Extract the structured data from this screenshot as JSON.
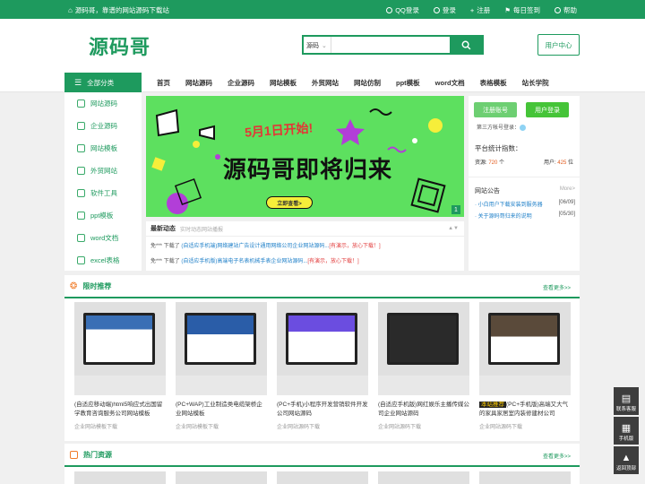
{
  "topbar": {
    "slogan": "源码哥，靠谱的网站源码下载站",
    "links": [
      "QQ登录",
      "登录",
      "注册",
      "每日签到",
      "帮助"
    ]
  },
  "header": {
    "logo": "源码哥",
    "search_type": "源码",
    "search_placeholder": "",
    "user_center": "用户中心"
  },
  "nav": {
    "all_label": "全部分类",
    "items": [
      "首页",
      "网站源码",
      "企业源码",
      "网站模板",
      "外贸网站",
      "网站仿制",
      "ppt模板",
      "word文档",
      "表格模板",
      "站长学院"
    ]
  },
  "sidebar": {
    "items": [
      "网站源码",
      "企业源码",
      "网站模板",
      "外贸网站",
      "软件工具",
      "ppt模板",
      "word文档",
      "excel表格"
    ]
  },
  "banner": {
    "date_text": "5月1日开始!",
    "headline": "源码哥即将归来",
    "button": "立即查看>",
    "page_num": "1"
  },
  "news": {
    "title": "最新动态",
    "subtitle": "实时动态网站播报",
    "rows": [
      {
        "user": "免***",
        "verb": "下载了",
        "title": "(自适应手机端)网络建站广告设计通用网络公司企业网站源码...",
        "tag": "[有演示，放心下载！]"
      },
      {
        "user": "免***",
        "verb": "下载了",
        "title": "(自适应手机版)高端电子名表机械手表企业网站源码...",
        "tag": "[有演示，放心下载！]"
      }
    ]
  },
  "right_panel": {
    "register": "注册账号",
    "login": "用户登录",
    "third_party": "第三方帐号登录：",
    "stats_title": "平台统计指数：",
    "resources_label": "资源:",
    "resources_value": "720",
    "resources_unit": "个",
    "users_label": "用户:",
    "users_value": "425",
    "users_unit": "位",
    "notice_title": "网站公告",
    "notice_more": "More>",
    "notices": [
      {
        "text": "· 小白用户下载安装到服务器",
        "date": "[06/09]"
      },
      {
        "text": "· 关于源码哥归来的说明",
        "date": "[05/30]"
      }
    ]
  },
  "limited": {
    "title": "限时推荐",
    "more": "查看更多>>",
    "cards": [
      {
        "title": "(自适应移动端)html5响应式出国留学教育咨询服务公司网站模板",
        "cat": "企业网站模板下载",
        "badge": ""
      },
      {
        "title": "(PC+WAP)工业制造类电缆架桥企业网站模板",
        "cat": "企业网站模板下载",
        "badge": ""
      },
      {
        "title": "(PC+手机)小程序开发营销软件开发公司网站源码",
        "cat": "企业网站源码下载",
        "badge": ""
      },
      {
        "title": "(自适应手机版)网红娱乐主播传媒公司企业网站源码",
        "cat": "企业网站源码下载",
        "badge": ""
      },
      {
        "title": "(PC+手机版)高端又大气的家具家居室内装修建材公司",
        "cat": "企业网站源码下载",
        "badge": "本站推荐"
      }
    ]
  },
  "hot": {
    "title": "热门资源",
    "more": "查看更多>>"
  },
  "float": {
    "service": "联系客服",
    "mobile": "手机版",
    "top": "返回顶部"
  },
  "colors": {
    "brand": "#1e9a5e",
    "banner_bg": "#5de05f",
    "register_btn": "#6dcf72",
    "login_btn": "#45c438"
  }
}
